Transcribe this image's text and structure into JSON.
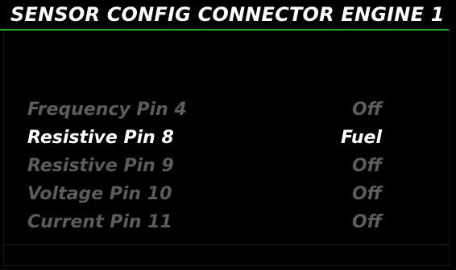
{
  "header": {
    "title": "SENSOR CONFIG CONNECTOR ENGINE 1"
  },
  "colors": {
    "background": "#000000",
    "accent_rule": "#1faa2f",
    "selected_text": "#ffffff",
    "dimmed_text": "#5c5c5c"
  },
  "list": {
    "selected_index": 1,
    "items": [
      {
        "label": "Frequency Pin 4",
        "value": "Off"
      },
      {
        "label": "Resistive Pin 8",
        "value": "Fuel"
      },
      {
        "label": "Resistive Pin 9",
        "value": "Off"
      },
      {
        "label": "Voltage Pin 10",
        "value": "Off"
      },
      {
        "label": "Current Pin 11",
        "value": "Off"
      }
    ]
  }
}
